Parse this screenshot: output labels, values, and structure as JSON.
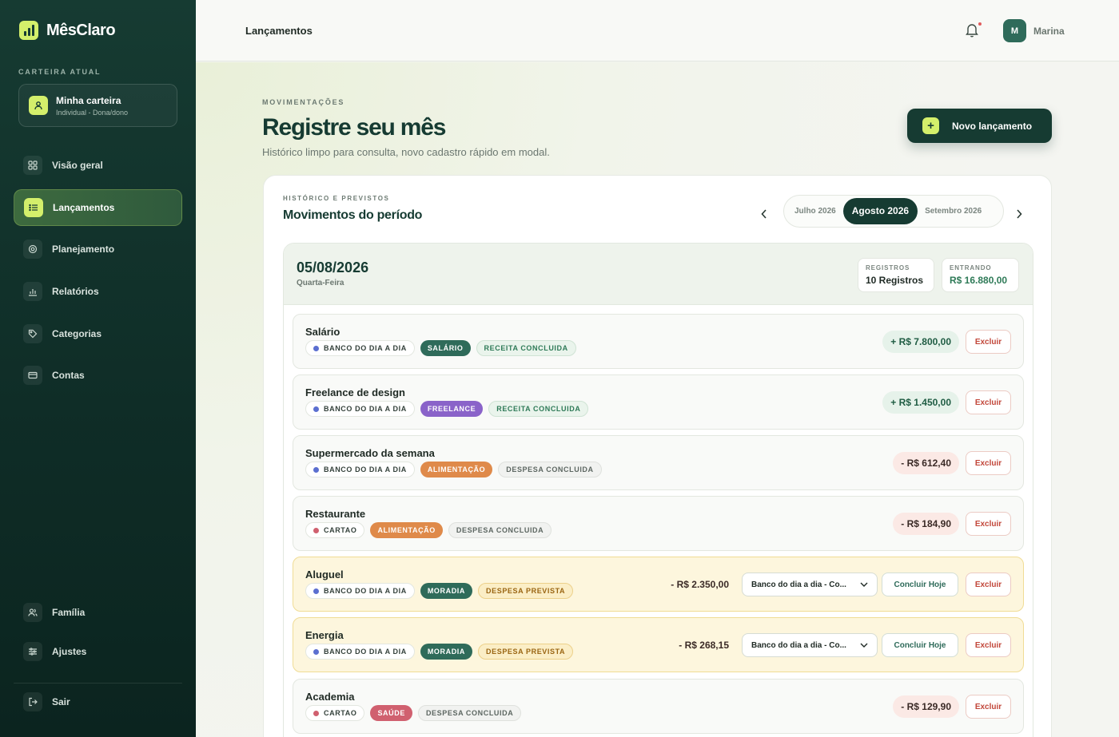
{
  "app": {
    "name": "MêsClaro"
  },
  "sidebar": {
    "wallet_label": "CARTEIRA ATUAL",
    "wallet_name": "Minha carteira",
    "wallet_sub": "Individual - Dona/dono",
    "items": [
      {
        "label": "Visão geral",
        "icon": "grid-icon"
      },
      {
        "label": "Lançamentos",
        "icon": "list-icon"
      },
      {
        "label": "Planejamento",
        "icon": "target-icon"
      },
      {
        "label": "Relatórios",
        "icon": "bar-chart-icon"
      },
      {
        "label": "Categorias",
        "icon": "tag-icon"
      },
      {
        "label": "Contas",
        "icon": "wallet-icon"
      }
    ],
    "bottom_items": [
      {
        "label": "Família",
        "icon": "users-icon"
      },
      {
        "label": "Ajustes",
        "icon": "sliders-icon"
      },
      {
        "label": "Sair",
        "icon": "logout-icon"
      }
    ]
  },
  "topbar": {
    "title": "Lançamentos",
    "user_initial": "M",
    "user_name": "Marina"
  },
  "header": {
    "eyebrow": "MOVIMENTAÇÕES",
    "title": "Registre seu mês",
    "subtitle": "Histórico limpo para consulta, novo cadastro rápido em modal.",
    "new_button": "Novo lançamento"
  },
  "panel": {
    "eyebrow": "HISTÓRICO E PREVISTOS",
    "title": "Movimentos do período",
    "months": [
      "Julho 2026",
      "Agosto 2026",
      "Setembro 2026"
    ],
    "active_month": "Agosto 2026"
  },
  "day": {
    "date": "05/08/2026",
    "weekday": "Quarta-Feira",
    "registros_label": "REGISTROS",
    "registros_value": "10 Registros",
    "entrando_label": "ENTRANDO",
    "entrando_value": "R$ 16.880,00"
  },
  "transactions": [
    {
      "name": "Salário",
      "account": "BANCO DO DIA A DIA",
      "category": "SALÁRIO",
      "status": "RECEITA CONCLUIDA",
      "amount": "+ R$ 7.800,00",
      "delete": "Excluir"
    },
    {
      "name": "Freelance de design",
      "account": "BANCO DO DIA A DIA",
      "category": "FREELANCE",
      "status": "RECEITA CONCLUIDA",
      "amount": "+ R$ 1.450,00",
      "delete": "Excluir"
    },
    {
      "name": "Supermercado da semana",
      "account": "BANCO DO DIA A DIA",
      "category": "ALIMENTAÇÃO",
      "status": "DESPESA CONCLUIDA",
      "amount": "- R$ 612,40",
      "delete": "Excluir"
    },
    {
      "name": "Restaurante",
      "account": "CARTAO",
      "category": "ALIMENTAÇÃO",
      "status": "DESPESA CONCLUIDA",
      "amount": "- R$ 184,90",
      "delete": "Excluir"
    },
    {
      "name": "Aluguel",
      "account": "BANCO DO DIA A DIA",
      "category": "MORADIA",
      "status": "DESPESA PREVISTA",
      "amount": "- R$ 2.350,00",
      "select": "Banco do dia a dia - Co...",
      "conclude": "Concluir Hoje",
      "delete": "Excluir"
    },
    {
      "name": "Energia",
      "account": "BANCO DO DIA A DIA",
      "category": "MORADIA",
      "status": "DESPESA PREVISTA",
      "amount": "- R$ 268,15",
      "select": "Banco do dia a dia - Co...",
      "conclude": "Concluir Hoje",
      "delete": "Excluir"
    },
    {
      "name": "Academia",
      "account": "CARTAO",
      "category": "SAÚDE",
      "status": "DESPESA CONCLUIDA",
      "amount": "- R$ 129,90",
      "delete": "Excluir"
    }
  ],
  "colors": {
    "sidebar_bg": "#163b32",
    "accent_lime": "#d4ef6b",
    "cat_salario": "#2f6b5a",
    "cat_freelance": "#8a63c9",
    "cat_alimentacao": "#df8a4a",
    "cat_moradia": "#2f6b5a",
    "cat_saude": "#d0606f",
    "danger": "#c2473a"
  }
}
